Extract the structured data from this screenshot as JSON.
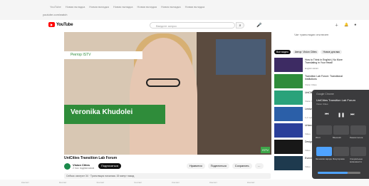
{
  "browser": {
    "tabs": [
      "YouTube",
      "Новая вкладка",
      "Новая вкладка",
      "Новая вкладка",
      "Новая вкладка",
      "Новая вкладка",
      "Новая вкладка"
    ],
    "address": "youtube.com/watch"
  },
  "header": {
    "logo_text": "YouTube",
    "search_placeholder": "Введите запрос",
    "search_glyph": "⌕",
    "mic_glyph": "🎤",
    "icons": [
      "＋",
      "🔔",
      "●"
    ]
  },
  "video": {
    "lower_third_name": "Veronika Khudolei",
    "lower_third_role": "Ректор ISTV",
    "corner_label": "ISTV",
    "title": "UniCities Transition Lab Forum",
    "channel_name": "Vision Cities",
    "channel_subs": "2 тыс подписчиков",
    "subscribe_label": "Подписаться",
    "actions": [
      "Нравится",
      "Поделиться",
      "Сохранить",
      "…"
    ],
    "description": "Сейчас смотрят 34 · Трансляция началась 15 минут назад"
  },
  "sidebar": {
    "note": "Чат трансляции отключен",
    "chips": [
      "Все видео",
      "Автор: Vision Cities",
      "Новое для вас"
    ],
    "videos": [
      {
        "title": "How to Think in English | No More Translating in Your Head!",
        "meta": "English Addict",
        "thumb_color": "#3d2b63"
      },
      {
        "title": "Transition Lab Forum: Transitional Institutions",
        "meta": "Vision Cities",
        "thumb_color": "#2f8c3a"
      },
      {
        "title": "UniCities Transition Lab Forum",
        "meta": "Vision Cities",
        "thumb_color": "#2aa27a"
      },
      {
        "title": "Lecture on Cities",
        "meta": "1,2 тыс просмотров",
        "thumb_color": "#2b5fa8"
      },
      {
        "title": "Urban Futures",
        "meta": "Video",
        "thumb_color": "#2a3f9a"
      },
      {
        "title": "Design Talk",
        "meta": "Video",
        "thumb_color": "#181818"
      },
      {
        "title": "Evening Stream",
        "meta": "Video",
        "thumb_color": "#1e3a4e"
      }
    ]
  },
  "mini_panel": {
    "header": "Google Chrome",
    "title": "UniCities Transition Lab Forum",
    "channel": "Vision Cities",
    "controls": [
      "⏮",
      "❚❚",
      "⏭"
    ],
    "tiles": [
      "Wi-Fi",
      "Bluetooth",
      "Режим полета",
      "Экономия заряда",
      "Фокусировка",
      "Специальные возможности"
    ],
    "volume_level": 0.7
  },
  "bottom_strip": [
    "Контакт",
    "Контакт",
    "Контакт",
    "Контакт",
    "Контакт",
    "Контакт",
    "Контакт"
  ]
}
